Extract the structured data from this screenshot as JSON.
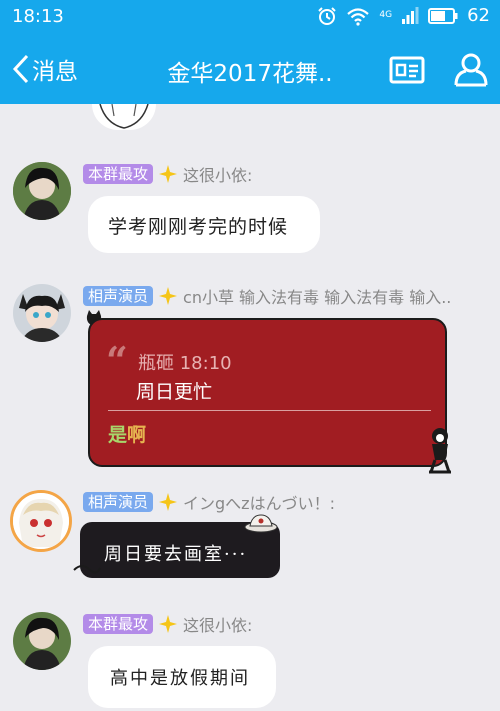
{
  "status_bar": {
    "time": "18:13",
    "network": "4G",
    "battery": "62"
  },
  "nav": {
    "back_label": "消息",
    "title": "金华2017花舞..",
    "profile_card_icon": "profile-card-icon",
    "group_members_icon": "person-icon"
  },
  "messages": [
    {
      "badge": "本群最攻",
      "nick": "这很小依:",
      "text": "学考刚刚考完的时候"
    },
    {
      "badge": "相声演员",
      "nick": "cn小草  输入法有毒  输入法有毒  输入..",
      "quote_name": "瓶砸 18:10",
      "quote_text": "周日更忙",
      "reply_part1": "是",
      "reply_part2": "啊"
    },
    {
      "badge": "相声演员",
      "nick": "インgへzはんづい！:",
      "text": "周日要去画室···"
    },
    {
      "badge": "本群最攻",
      "nick": "这很小依:",
      "text": "高中是放假期间"
    }
  ],
  "colors": {
    "header": "#16a8ec",
    "background": "#ececf0",
    "badge_purple": "#b38be8",
    "badge_blue": "#7aa9ee",
    "rich_bubble": "#a11d22"
  }
}
